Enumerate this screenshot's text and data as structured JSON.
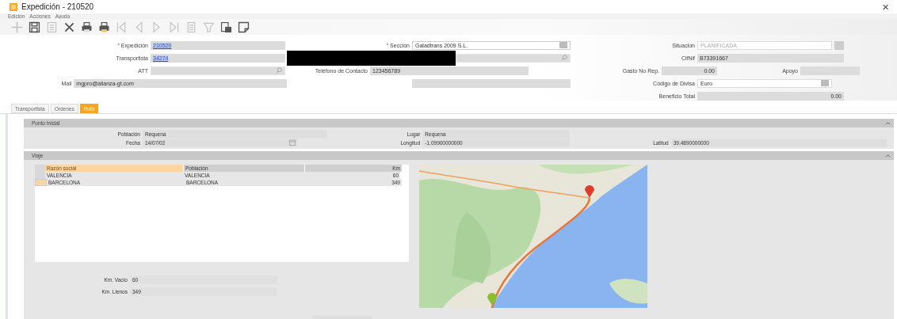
{
  "window": {
    "title": "Expedición - 210520",
    "close": "×"
  },
  "menu": [
    {
      "label": "Edición"
    },
    {
      "label": "Acciones"
    },
    {
      "label": "Ayuda"
    }
  ],
  "toolbar": [
    {
      "kind": "add",
      "disabled": true
    },
    {
      "kind": "save",
      "disabled": false
    },
    {
      "kind": "copy",
      "disabled": true
    },
    {
      "kind": "delete",
      "disabled": false
    },
    {
      "kind": "print",
      "disabled": false
    },
    {
      "kind": "print-preview",
      "disabled": false
    },
    {
      "kind": "first",
      "disabled": true
    },
    {
      "kind": "prev",
      "disabled": true
    },
    {
      "kind": "next",
      "disabled": true
    },
    {
      "kind": "last",
      "disabled": true
    },
    {
      "kind": "list",
      "disabled": true
    },
    {
      "kind": "filter",
      "disabled": true
    },
    {
      "kind": "report",
      "disabled": false
    },
    {
      "kind": "note",
      "disabled": false
    }
  ],
  "form": {
    "left": [
      {
        "kind": "link",
        "label": "Expedición",
        "value": "210520",
        "mark": "*"
      },
      {
        "kind": "link",
        "label": "Transportista",
        "value": "34274"
      },
      {
        "kind": "search",
        "label": "ATT"
      },
      {
        "kind": "text",
        "label": "Mail",
        "value": "mgpro@alianza-gt.com"
      }
    ],
    "middle": [
      {
        "kind": "select",
        "label": "Sección",
        "value": "Galadtrans 2009 S.L.",
        "mark": "*"
      },
      {
        "kind": "redacted-search"
      },
      {
        "kind": "text",
        "label": "Teléfono de Contacto",
        "value": "123456789"
      },
      {
        "kind": "blank"
      }
    ],
    "right": [
      {
        "kind": "status",
        "label": "Situacion",
        "value": "PLANIFICADA",
        "disabled": true
      },
      {
        "kind": "text",
        "label": "CifNif",
        "value": "B73391667"
      },
      {
        "kind": "pair",
        "label": "Gasto No Rep.",
        "value": "0.00",
        "label2": "Apoyo"
      },
      {
        "kind": "select",
        "label": "Código de Divisa",
        "value": "Euro"
      },
      {
        "kind": "number",
        "label": "Beneficio Total",
        "value": "0.00"
      }
    ]
  },
  "tabs": [
    {
      "label": "Transportista",
      "selected": false
    },
    {
      "label": "Ordenes",
      "selected": false
    },
    {
      "label": "Ruta",
      "selected": true
    }
  ],
  "start_panel": {
    "title": "Punto Inicial",
    "poblacion_label": "Población",
    "poblacion": "Requena",
    "fecha_label": "Fecha",
    "fecha": "14/07/02",
    "lugar_label": "Lugar",
    "lugar": "Requena",
    "longitud_label": "Longitud",
    "longitud": "-1.09900000000",
    "latitud_label": "Latitud",
    "latitud": "39.4890000000"
  },
  "trip_panel": {
    "title": "Viaje",
    "table": {
      "columns": [
        "Razón social",
        "Población",
        "Km"
      ],
      "rows": [
        {
          "cells": [
            "VALENCIA",
            "VALENCIA",
            "60"
          ],
          "selected": false
        },
        {
          "cells": [
            "BARCELONA",
            "BARCELONA",
            "349"
          ],
          "selected": true
        }
      ]
    },
    "km_vacio_label": "Km. Vacío",
    "km_vacio": "60",
    "km_llenos_label": "Km. Llenos",
    "km_llenos": "349"
  }
}
